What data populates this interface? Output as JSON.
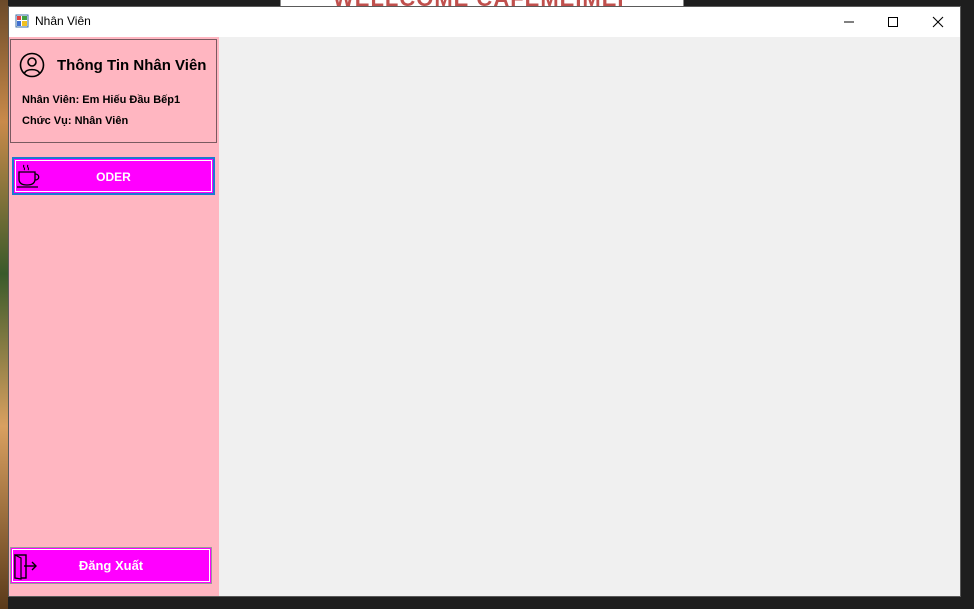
{
  "window": {
    "title": "Nhân Viên"
  },
  "background_window": {
    "partial_text": "WELLCOME CAFEMEIMEI"
  },
  "info": {
    "title": "Thông Tin Nhân Viên",
    "employee_line": "Nhân Viên: Em Hiếu Đầu Bếp1",
    "role_line": "Chức Vụ: Nhân Viên",
    "icon": "user-circle-icon"
  },
  "sidebar": {
    "oder_label": "ODER",
    "oder_icon": "coffee-cup-icon",
    "logout_label": "Đăng Xuất",
    "logout_icon": "logout-door-icon"
  },
  "colors": {
    "sidebar_bg": "#ffb6c1",
    "button_bg": "#ff00ff",
    "content_bg": "#f0f0f0"
  }
}
